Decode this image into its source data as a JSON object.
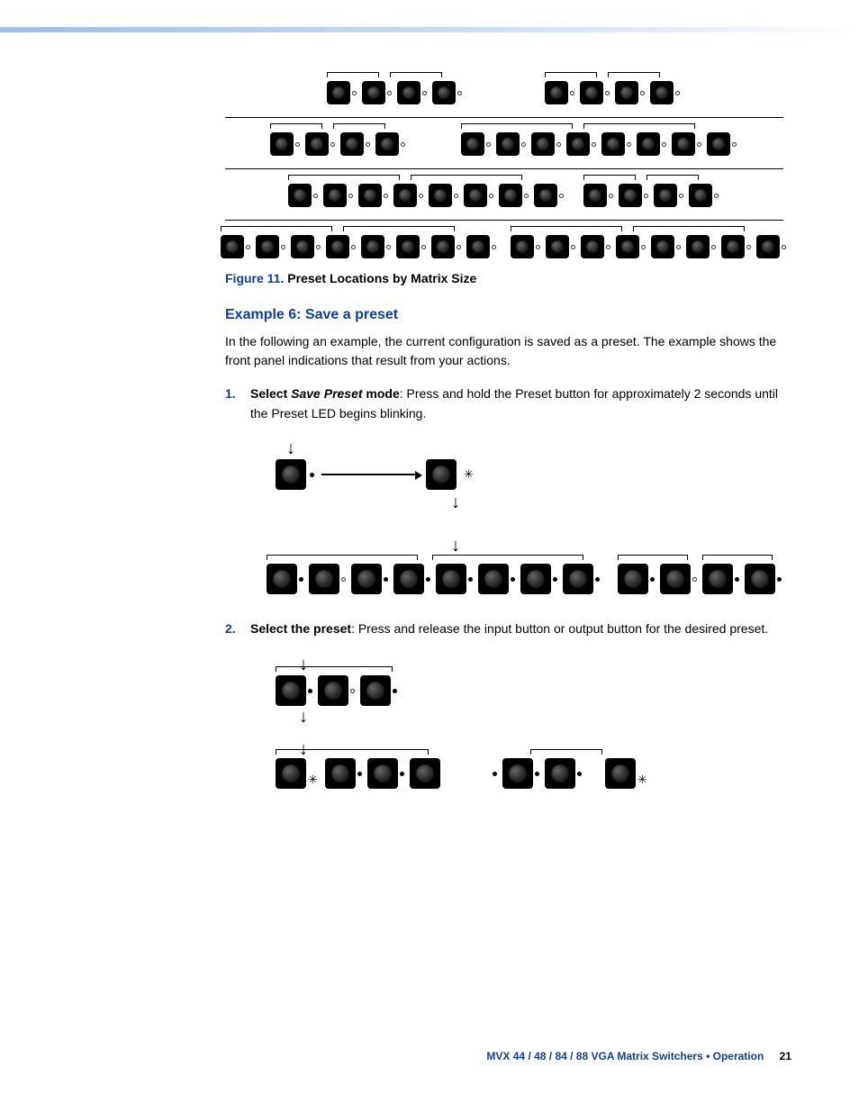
{
  "figure": {
    "number": "Figure 11.",
    "title": "Preset Locations by Matrix Size"
  },
  "heading": "Example 6: Save a preset",
  "intro": "In the following an example, the current configuration is saved as a preset. The example shows the front panel indications that result from your actions.",
  "steps": {
    "one": {
      "num": "1.",
      "lead_bold": "Select ",
      "lead_boldital": "Save Preset",
      "lead_bold2": " mode",
      "tail": ": Press and hold the Preset button for approximately 2 seconds until the Preset LED begins blinking."
    },
    "two": {
      "num": "2.",
      "lead_bold": "Select the preset",
      "tail": ": Press and release the input button or output button for the desired preset."
    }
  },
  "footer": {
    "text": "MVX 44 / 48 / 84 / 88 VGA Matrix Switchers • Operation",
    "page": "21"
  }
}
